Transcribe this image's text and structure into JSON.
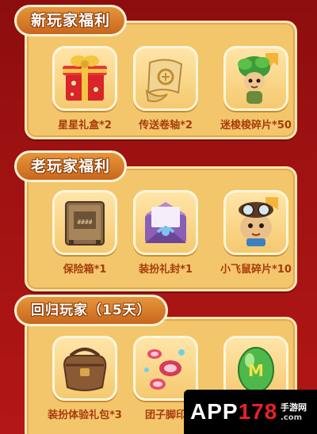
{
  "sections": [
    {
      "title": "新玩家福利",
      "items": [
        {
          "label": "星星礼盒*2",
          "icon": "gift-box-icon"
        },
        {
          "label": "传送卷轴*2",
          "icon": "scroll-icon"
        },
        {
          "label": "迷梭梭碎片*50",
          "icon": "leaf-character-icon"
        }
      ]
    },
    {
      "title": "老玩家福利",
      "items": [
        {
          "label": "保险箱*1",
          "icon": "safe-icon"
        },
        {
          "label": "装扮礼封*1",
          "icon": "envelope-icon"
        },
        {
          "label": "小飞鼠碎片*10",
          "icon": "flying-squirrel-icon"
        }
      ]
    },
    {
      "title": "回归玩家（15天）",
      "items": [
        {
          "label": "装扮体验礼包*3",
          "icon": "bag-icon"
        },
        {
          "label": "团子脚印",
          "icon": "footprint-icon"
        },
        {
          "label": "",
          "icon": "green-egg-icon"
        }
      ]
    }
  ],
  "watermark": {
    "brand_main": "APP",
    "brand_num": "178",
    "brand_suffix": ".com",
    "sub": "手游网"
  }
}
